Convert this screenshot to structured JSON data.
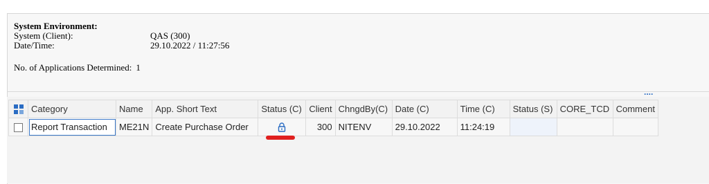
{
  "env": {
    "title": "System Environment:",
    "system_label": "System (Client):",
    "system_value": "QAS (300)",
    "datetime_label": "Date/Time:",
    "datetime_value": "29.10.2022 / 11:27:56",
    "apps_label": "No. of Applications Determined:",
    "apps_value": "1"
  },
  "more_indicator": "....",
  "grid": {
    "headers": [
      "Category",
      "Name",
      "App. Short Text",
      "Status (C)",
      "Client",
      "ChngdBy(C)",
      "Date (C)",
      "Time (C)",
      "Status (S)",
      "CORE_TCD",
      "Comment"
    ],
    "row": {
      "category": "Report Transaction",
      "name": "ME21N",
      "short_text": "Create Purchase Order",
      "status_c_icon": "lock-icon",
      "client": "300",
      "changed_by": "NITENV",
      "date": "29.10.2022",
      "time": "11:24:19",
      "status_s": "",
      "core_tcd": "",
      "comment": ""
    }
  },
  "colors": {
    "accent": "#2a6cc3",
    "annotation_red": "#e0201f"
  }
}
